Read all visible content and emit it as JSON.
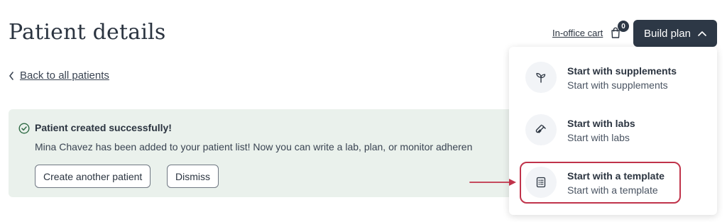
{
  "page": {
    "title": "Patient details"
  },
  "nav": {
    "back_label": "Back to all patients"
  },
  "header": {
    "cart_label": "In-office cart",
    "cart_count": "0",
    "build_plan_label": "Build plan"
  },
  "banner": {
    "title": "Patient created successfully!",
    "message": "Mina Chavez has been added to your patient list! Now you can write a lab, plan, or monitor adheren",
    "create_label": "Create another patient",
    "dismiss_label": "Dismiss"
  },
  "dropdown": {
    "items": [
      {
        "title": "Start with supplements",
        "subtitle": "Start with supplements",
        "icon": "sprout-icon"
      },
      {
        "title": "Start with labs",
        "subtitle": "Start with labs",
        "icon": "test-tube-icon"
      },
      {
        "title": "Start with a template",
        "subtitle": "Start with a template",
        "icon": "template-icon"
      }
    ]
  },
  "colors": {
    "primary_dark": "#2d3846",
    "banner_bg": "#eaf1ec",
    "highlight": "#c0334a",
    "success_icon": "#2f6b45"
  }
}
